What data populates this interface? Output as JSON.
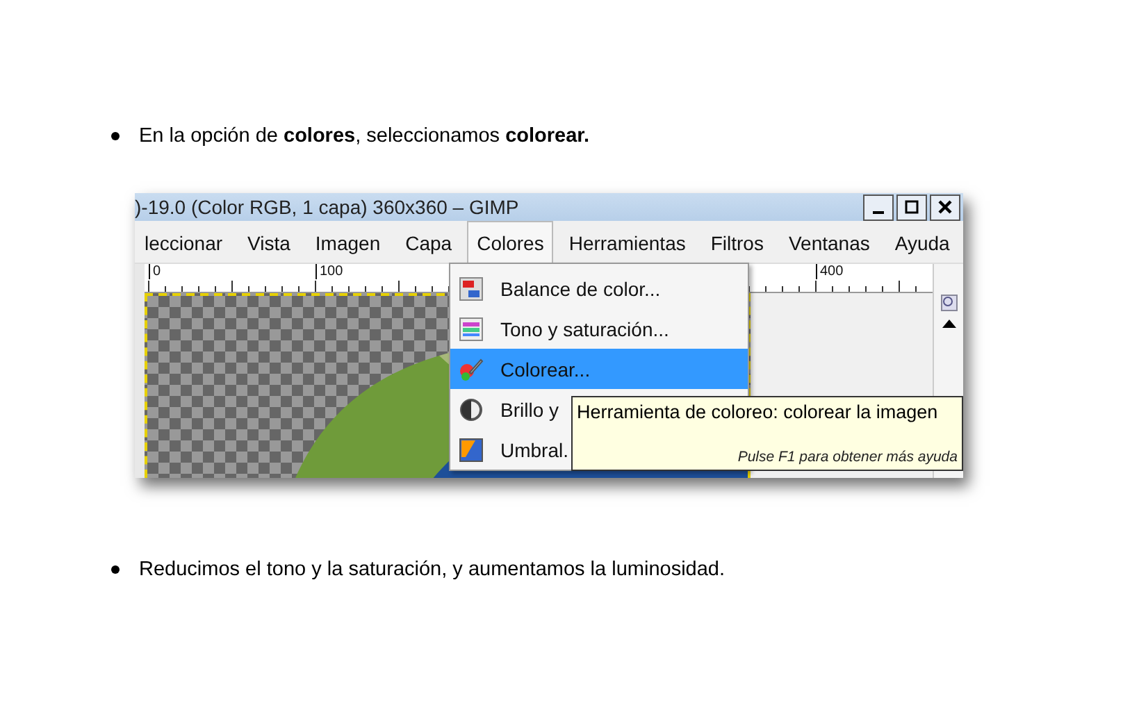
{
  "content": [
    {
      "kind": "bullet",
      "text": "En la opción de **colores**, seleccionamos **colorear.**"
    },
    {
      "kind": "screenshot",
      "title": ")-19.0 (Color RGB, 1 capa) 360x360 – GIMP",
      "menu": [
        {
          "label": "leccionar",
          "selected": false
        },
        {
          "label": "Vista",
          "selected": false
        },
        {
          "label": "Imagen",
          "selected": false
        },
        {
          "label": "Capa",
          "selected": false
        },
        {
          "label": "Colores",
          "selected": true
        },
        {
          "label": "Herramientas",
          "selected": false
        },
        {
          "label": "Filtros",
          "selected": false
        },
        {
          "label": "Ventanas",
          "selected": false
        },
        {
          "label": "Ayuda",
          "selected": false
        }
      ],
      "ruler_labels": [
        "0",
        "100",
        "400"
      ],
      "dropdown": [
        {
          "label": "Balance de color...",
          "selected": false
        },
        {
          "label": "Tono y saturación...",
          "selected": false
        },
        {
          "label": "Colorear...",
          "selected": true
        },
        {
          "label": "Brillo y",
          "selected": false
        },
        {
          "label": "Umbral.",
          "selected": false
        }
      ],
      "tooltip": {
        "title": "Herramienta de coloreo: colorear la imagen",
        "hint": "Pulse F1 para obtener más ayuda"
      }
    },
    {
      "kind": "bullet",
      "text": "Reducimos el tono y la saturación, y aumentamos la luminosidad."
    }
  ]
}
